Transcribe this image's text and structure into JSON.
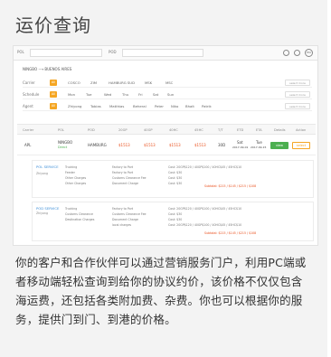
{
  "title": "运价查询",
  "topbar": {
    "pol_label": "POL",
    "pod_label": "POD",
    "right_label": "EN"
  },
  "route": "NINGBO ⟶ BUENOS AIRES",
  "filters": [
    {
      "label": "Carrier",
      "chip": "All",
      "options": [
        "COSCO",
        "ZIM",
        "HAMBURG SUD",
        "MSK",
        "MSC"
      ],
      "select": "select more"
    },
    {
      "label": "Schedule",
      "chip": "All",
      "options": [
        "Mon",
        "Tue",
        "Wed",
        "Thu",
        "Fri",
        "Sat",
        "Sun"
      ],
      "select": "select more"
    },
    {
      "label": "Agent",
      "chip": "All",
      "options": [
        "Zhiyong",
        "Tobias",
        "Matthias",
        "Beheral",
        "Peter",
        "Niko",
        "Bhait",
        "Patrik"
      ],
      "select": "select more"
    }
  ],
  "table": {
    "headers": [
      "Carrier",
      "POL",
      "POD",
      "20GP",
      "40GP",
      "40HC",
      "45HC",
      "T/T",
      "ETD",
      "ETA",
      "Details",
      "Action"
    ],
    "row": {
      "carrier": "APL",
      "pol": "NINGBO",
      "pol_sub": "Direct",
      "pod": "HAMBURG",
      "p20": "$1513",
      "p40": "$1513",
      "p40hc": "$1513",
      "p45": "$1513",
      "tt": "30D",
      "etd": "Sat",
      "etd_date": "2017-09-01",
      "eta": "Tue",
      "eta_date": "2017-09-15",
      "view": "view",
      "select": "select"
    }
  },
  "details": [
    {
      "title": "POL SERVICE",
      "agent": "Zhiyong",
      "items": [
        "Trucking",
        "Feeder",
        "Other Charges",
        "Other Charges"
      ],
      "descs": [
        "Factory to Port",
        "Factory to Port",
        "Customs Clearance Fee",
        "Document Charge"
      ],
      "costs": [
        "Cost: 20GP$120 / 40GP$100 / 40HC$45 / 45HC$10",
        "Cost: $30",
        "Cost: $30",
        "Cost: $30"
      ],
      "subtotal": "Subtotal: $215 / $145 / $215 / $108"
    },
    {
      "title": "POD SERVICE",
      "agent": "Zhiyong",
      "items": [
        "Trucking",
        "Customs Clearance",
        "Destination Charges"
      ],
      "descs": [
        "Factory to Port",
        "Customs Clearance Fee",
        "Document Charge",
        "local charges"
      ],
      "costs": [
        "Cost: 20GP$120 / 40GP$100 / 40HC$45 / 45HC$10",
        "Cost: $30",
        "Cost: $30",
        "Cost: 20GP$120 / 40GP$100 / 40HC$45 / 45HC$10"
      ],
      "subtotal": "Subtotal: $215 / $145 / $215 / $108"
    }
  ],
  "paragraph": "你的客户和合作伙伴可以通过营销服务门户，利用PC端或者移动端轻松查询到给你的协议约价，该价格不仅仅包含海运费，还包括各类附加费、杂费。你也可以根据你的服务，提供门到门、到港的价格。"
}
